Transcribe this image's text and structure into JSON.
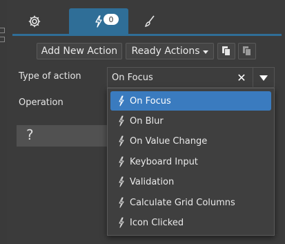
{
  "tabs": [
    {
      "name": "settings",
      "icon": "gear-icon"
    },
    {
      "name": "actions",
      "icon": "lightning-icon",
      "badge": "0"
    },
    {
      "name": "style",
      "icon": "brush-icon"
    }
  ],
  "toolbar": {
    "add_label": "Add New Action",
    "ready_label": "Ready Actions",
    "copy_icon": "copy-icon",
    "paste_icon": "paste-icon"
  },
  "form": {
    "type_label": "Type of action",
    "type_value": "On Focus",
    "operation_label": "Operation",
    "help_text": "?"
  },
  "dropdown": {
    "options": [
      "On Focus",
      "On Blur",
      "On Value Change",
      "Keyboard Input",
      "Validation",
      "Calculate Grid Columns",
      "Icon Clicked"
    ],
    "selected": "On Focus"
  },
  "colors": {
    "accent": "#2f6e97",
    "selected_option": "#3a7bbf",
    "background": "#3b3b3b"
  }
}
